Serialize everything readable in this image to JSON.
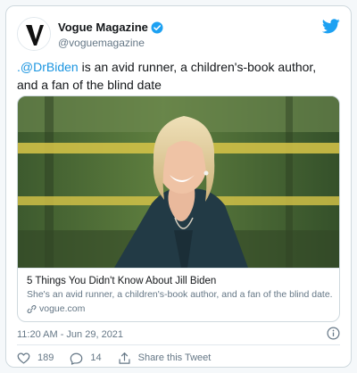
{
  "account": {
    "display_name": "Vogue Magazine",
    "handle": "@voguemagazine",
    "verified": true,
    "avatar_icon": "vogue-v-logo-icon",
    "brand_icon": "twitter-bird-icon",
    "brand_color": "#1da1f2"
  },
  "tweet": {
    "mention": ".@DrBiden",
    "text": " is an avid runner, a children's-book author, and a fan of the blind date"
  },
  "link_card": {
    "image_icon": "jill-biden-photo",
    "title": "5 Things You Didn't Know About Jill Biden",
    "description": "She's an avid runner, a children's-book author, and a fan of the blind date.",
    "domain": "vogue.com",
    "domain_icon": "link-icon"
  },
  "meta": {
    "timestamp": "11:20 AM - Jun 29, 2021",
    "info_icon": "info-icon"
  },
  "actions": {
    "like_count": "189",
    "reply_count": "14",
    "share_label": "Share this Tweet"
  }
}
